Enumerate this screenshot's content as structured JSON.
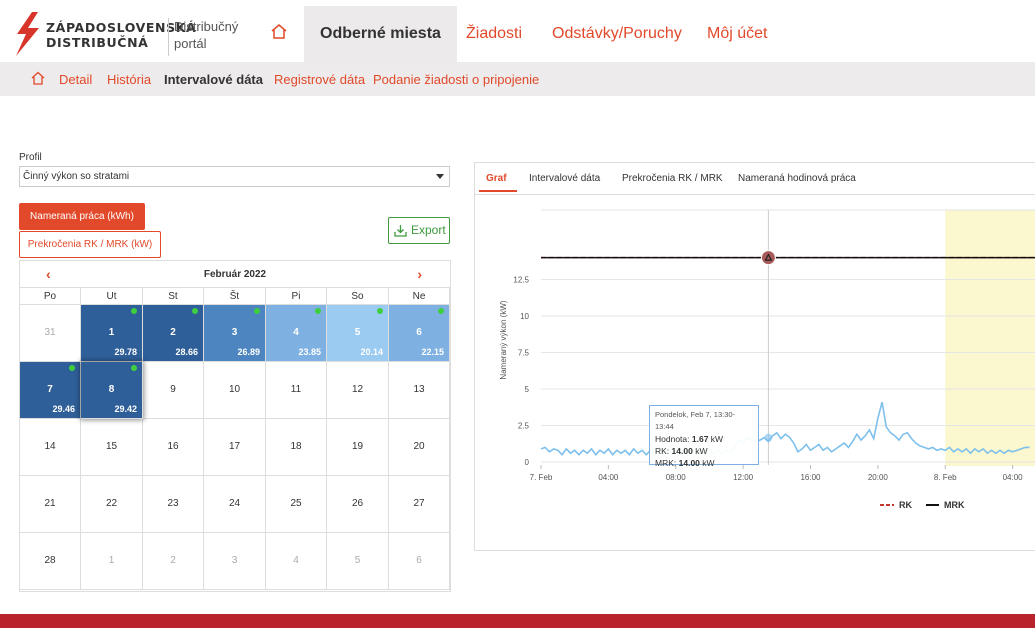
{
  "brand": {
    "line1": "ZÁPADOSLOVENSKÁ",
    "line2": "DISTRIBUČNÁ",
    "portal_line1": "Distribučný",
    "portal_line2": "portál"
  },
  "nav": {
    "items": [
      "Odberné miesta",
      "Žiadosti",
      "Odstávky/Poruchy",
      "Môj účet"
    ],
    "active": "Odberné miesta"
  },
  "subnav": {
    "items": [
      "Detail",
      "História",
      "Intervalové dáta",
      "Registrové dáta",
      "Podanie žiadosti o pripojenie"
    ],
    "active": "Intervalové dáta"
  },
  "profil": {
    "label": "Profil",
    "value": "Činný výkon so stratami"
  },
  "buttons": {
    "nameranie": "Nameraná práca (kWh)",
    "prekrocenia": "Prekročenia RK / MRK (kW)",
    "export": "Export"
  },
  "calendar": {
    "title": "Február 2022",
    "prev": "‹",
    "next": "›",
    "weekdays": [
      "Po",
      "Ut",
      "St",
      "Št",
      "Pi",
      "So",
      "Ne"
    ],
    "days": [
      {
        "n": "31",
        "other": true
      },
      {
        "n": "1",
        "v": "29.78",
        "shade": "dark"
      },
      {
        "n": "2",
        "v": "28.66",
        "shade": "dark"
      },
      {
        "n": "3",
        "v": "26.89",
        "shade": "mid"
      },
      {
        "n": "4",
        "v": "23.85",
        "shade": "light"
      },
      {
        "n": "5",
        "v": "20.14",
        "shade": "pale"
      },
      {
        "n": "6",
        "v": "22.15",
        "shade": "light"
      },
      {
        "n": "7",
        "v": "29.46",
        "shade": "dark"
      },
      {
        "n": "8",
        "v": "29.42",
        "shade": "dark",
        "raised": true
      },
      {
        "n": "9"
      },
      {
        "n": "10"
      },
      {
        "n": "11"
      },
      {
        "n": "12"
      },
      {
        "n": "13"
      },
      {
        "n": "14"
      },
      {
        "n": "15"
      },
      {
        "n": "16"
      },
      {
        "n": "17"
      },
      {
        "n": "18"
      },
      {
        "n": "19"
      },
      {
        "n": "20"
      },
      {
        "n": "21"
      },
      {
        "n": "22"
      },
      {
        "n": "23"
      },
      {
        "n": "24"
      },
      {
        "n": "25"
      },
      {
        "n": "26"
      },
      {
        "n": "27"
      },
      {
        "n": "28"
      },
      {
        "n": "1",
        "other": true
      },
      {
        "n": "2",
        "other": true
      },
      {
        "n": "3",
        "other": true
      },
      {
        "n": "4",
        "other": true
      },
      {
        "n": "5",
        "other": true
      },
      {
        "n": "6",
        "other": true
      }
    ]
  },
  "tabs": [
    "Graf",
    "Intervalové dáta",
    "Prekročenia RK / MRK",
    "Nameraná hodinová práca"
  ],
  "tooltip": {
    "title": "Pondelok, Feb 7, 13:30-13:44",
    "hodnota_label": "Hodnota:",
    "hodnota": "1.67",
    "unit": "kW",
    "rk_label": "RK:",
    "rk": "14.00",
    "mrk_label": "MRK:",
    "mrk": "14.00"
  },
  "chart_data": {
    "type": "line",
    "ylabel": "Nameraný výkon (kW)",
    "yticks": [
      "0",
      "2.5",
      "5",
      "7.5",
      "10",
      "12.5"
    ],
    "ylim": [
      0,
      15
    ],
    "xticks": [
      "7. Feb",
      "04:00",
      "08:00",
      "12:00",
      "16:00",
      "20:00",
      "8. Feb",
      "04:00"
    ],
    "x_hours": [
      0,
      4,
      8,
      12,
      16,
      20,
      24,
      28
    ],
    "series": [
      {
        "name": "RK",
        "color": "#c0392b",
        "style": "dashed",
        "values": [
          [
            0,
            14
          ],
          [
            30,
            14
          ]
        ]
      },
      {
        "name": "MRK",
        "color": "#111111",
        "style": "solid",
        "values": [
          [
            0,
            14
          ],
          [
            30,
            14
          ]
        ]
      },
      {
        "color": "#7ec0ec",
        "values": [
          [
            0,
            0.9
          ],
          [
            0.25,
            1.0
          ],
          [
            0.5,
            0.7
          ],
          [
            0.75,
            0.9
          ],
          [
            1,
            0.8
          ],
          [
            1.25,
            0.5
          ],
          [
            1.5,
            0.9
          ],
          [
            1.75,
            0.6
          ],
          [
            2,
            0.8
          ],
          [
            2.25,
            0.5
          ],
          [
            2.5,
            0.8
          ],
          [
            2.75,
            0.6
          ],
          [
            3,
            0.9
          ],
          [
            3.25,
            0.5
          ],
          [
            3.5,
            0.8
          ],
          [
            3.75,
            0.6
          ],
          [
            4,
            0.9
          ],
          [
            4.25,
            0.5
          ],
          [
            4.5,
            0.8
          ],
          [
            4.75,
            0.6
          ],
          [
            5,
            0.8
          ],
          [
            5.25,
            0.5
          ],
          [
            5.5,
            0.9
          ],
          [
            5.75,
            0.6
          ],
          [
            6,
            0.8
          ],
          [
            6.25,
            0.5
          ],
          [
            6.5,
            0.8
          ],
          [
            6.75,
            0.6
          ],
          [
            7,
            0.8
          ],
          [
            7.25,
            0.5
          ],
          [
            7.5,
            0.8
          ],
          [
            7.75,
            0.6
          ],
          [
            8,
            0.9
          ],
          [
            8.25,
            0.5
          ],
          [
            8.5,
            0.8
          ],
          [
            8.75,
            0.6
          ],
          [
            9,
            0.8
          ],
          [
            9.25,
            0.5
          ],
          [
            9.5,
            0.8
          ],
          [
            9.75,
            0.6
          ],
          [
            10,
            0.9
          ],
          [
            10.25,
            0.6
          ],
          [
            10.5,
            0.8
          ],
          [
            10.75,
            0.6
          ],
          [
            11,
            0.8
          ],
          [
            11.25,
            0.7
          ],
          [
            11.5,
            1.0
          ],
          [
            11.75,
            1.5
          ],
          [
            12,
            1.3
          ],
          [
            12.25,
            1.7
          ],
          [
            12.5,
            1.5
          ],
          [
            12.75,
            1.4
          ],
          [
            13,
            1.5
          ],
          [
            13.25,
            1.67
          ],
          [
            13.5,
            1.4
          ],
          [
            13.75,
            1.8
          ],
          [
            14,
            2.0
          ],
          [
            14.25,
            1.6
          ],
          [
            14.5,
            1.9
          ],
          [
            14.75,
            1.7
          ],
          [
            15,
            1.3
          ],
          [
            15.25,
            0.7
          ],
          [
            15.5,
            0.9
          ],
          [
            15.75,
            1.2
          ],
          [
            16,
            0.8
          ],
          [
            16.25,
            1.0
          ],
          [
            16.5,
            1.2
          ],
          [
            16.75,
            0.8
          ],
          [
            17,
            1.0
          ],
          [
            17.25,
            0.7
          ],
          [
            17.5,
            0.9
          ],
          [
            17.75,
            1.1
          ],
          [
            18,
            1.3
          ],
          [
            18.25,
            1.0
          ],
          [
            18.5,
            1.4
          ],
          [
            18.75,
            1.9
          ],
          [
            19,
            1.5
          ],
          [
            19.25,
            1.8
          ],
          [
            19.5,
            2.2
          ],
          [
            19.75,
            1.6
          ],
          [
            20,
            3.0
          ],
          [
            20.25,
            4.1
          ],
          [
            20.5,
            2.4
          ],
          [
            20.75,
            2.0
          ],
          [
            21,
            1.8
          ],
          [
            21.25,
            1.5
          ],
          [
            21.5,
            1.9
          ],
          [
            21.75,
            2.0
          ],
          [
            22,
            1.6
          ],
          [
            22.25,
            1.3
          ],
          [
            22.5,
            1.1
          ],
          [
            22.75,
            1.0
          ],
          [
            23,
            0.9
          ],
          [
            23.25,
            1.0
          ],
          [
            23.5,
            0.8
          ],
          [
            23.75,
            0.9
          ],
          [
            24,
            0.8
          ],
          [
            24.25,
            1.0
          ],
          [
            24.5,
            0.7
          ],
          [
            24.75,
            0.9
          ],
          [
            25,
            0.7
          ],
          [
            25.25,
            0.9
          ],
          [
            25.5,
            0.6
          ],
          [
            25.75,
            0.9
          ],
          [
            26,
            0.7
          ],
          [
            26.25,
            0.9
          ],
          [
            26.5,
            0.6
          ],
          [
            26.75,
            0.8
          ],
          [
            27,
            0.6
          ],
          [
            27.25,
            0.8
          ],
          [
            27.5,
            0.6
          ],
          [
            27.75,
            0.8
          ],
          [
            28,
            0.7
          ],
          [
            28.25,
            0.8
          ],
          [
            28.5,
            0.9
          ],
          [
            28.75,
            1.0
          ],
          [
            29,
            1.0
          ]
        ]
      }
    ],
    "highlight_from_hour": 24,
    "cursor_hour": 13.5,
    "legend": [
      "RK",
      "MRK"
    ],
    "legend_position": "bottom"
  }
}
